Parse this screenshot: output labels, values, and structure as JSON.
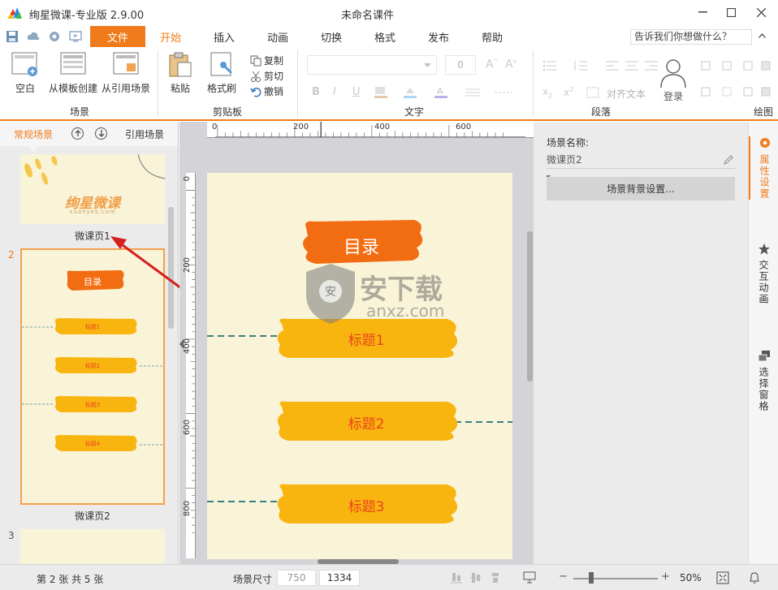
{
  "app": {
    "title": "绚星微课-专业版 2.9.00",
    "document_title": "未命名课件"
  },
  "menu": {
    "file_label": "文件",
    "tabs": [
      {
        "label": "开始",
        "active": true
      },
      {
        "label": "插入"
      },
      {
        "label": "动画"
      },
      {
        "label": "切换"
      },
      {
        "label": "格式"
      },
      {
        "label": "发布"
      },
      {
        "label": "帮助"
      }
    ],
    "help_search_placeholder": "告诉我们你想做什么？"
  },
  "ribbon": {
    "scene": {
      "blank": "空白",
      "from_template": "从模板创建",
      "from_reference": "从引用场景",
      "group_label": "场景"
    },
    "clipboard": {
      "paste": "粘贴",
      "format_painter": "格式刷",
      "copy": "复制",
      "cut": "剪切",
      "undo": "撤销",
      "group_label": "剪贴板"
    },
    "text": {
      "font_size": "0",
      "group_label": "文字"
    },
    "paragraph": {
      "align_text": "对齐文本",
      "group_label": "段落"
    },
    "login_label": "登录",
    "drawing_label": "绘图"
  },
  "left_panel": {
    "tab_normal": "常规场景",
    "tab_reference": "引用场景",
    "slides": [
      {
        "number": "1",
        "label": "微课页1",
        "logo_text": "绚星微课",
        "logo_sub": "xuanyes.com"
      },
      {
        "number": "2",
        "label": "微课页2",
        "title": "目录",
        "items": [
          "标题1",
          "标题2",
          "标题3",
          "标题4"
        ]
      },
      {
        "number": "3",
        "label": ""
      }
    ]
  },
  "canvas": {
    "ruler_h_labels": [
      "0",
      "200",
      "400",
      "600"
    ],
    "ruler_v_labels": [
      "0",
      "200",
      "400",
      "600",
      "800"
    ],
    "page_title": "目录",
    "headings": [
      "标题1",
      "标题2",
      "标题3"
    ],
    "watermark_text": "安下载",
    "watermark_sub": "anxz.com"
  },
  "properties": {
    "scene_name_label": "场景名称:",
    "scene_name_value": "微课页2",
    "bg_settings_button": "场景背景设置..."
  },
  "right_rail": {
    "items": [
      {
        "label": "属性设置",
        "active": true
      },
      {
        "label": "交互动画"
      },
      {
        "label": "选择窗格"
      }
    ]
  },
  "status": {
    "page_info": "第 2 张  共 5 张",
    "scene_size_label": "场景尺寸",
    "width": "750",
    "height": "1334",
    "zoom": "50%"
  },
  "colors": {
    "accent": "#f07b1c",
    "banner_orange": "#f26d12",
    "banner_yellow": "#f9b50f",
    "page_bg": "#f9f3d8",
    "heading_text": "#e8441c",
    "arrow_red": "#d61f1f"
  }
}
